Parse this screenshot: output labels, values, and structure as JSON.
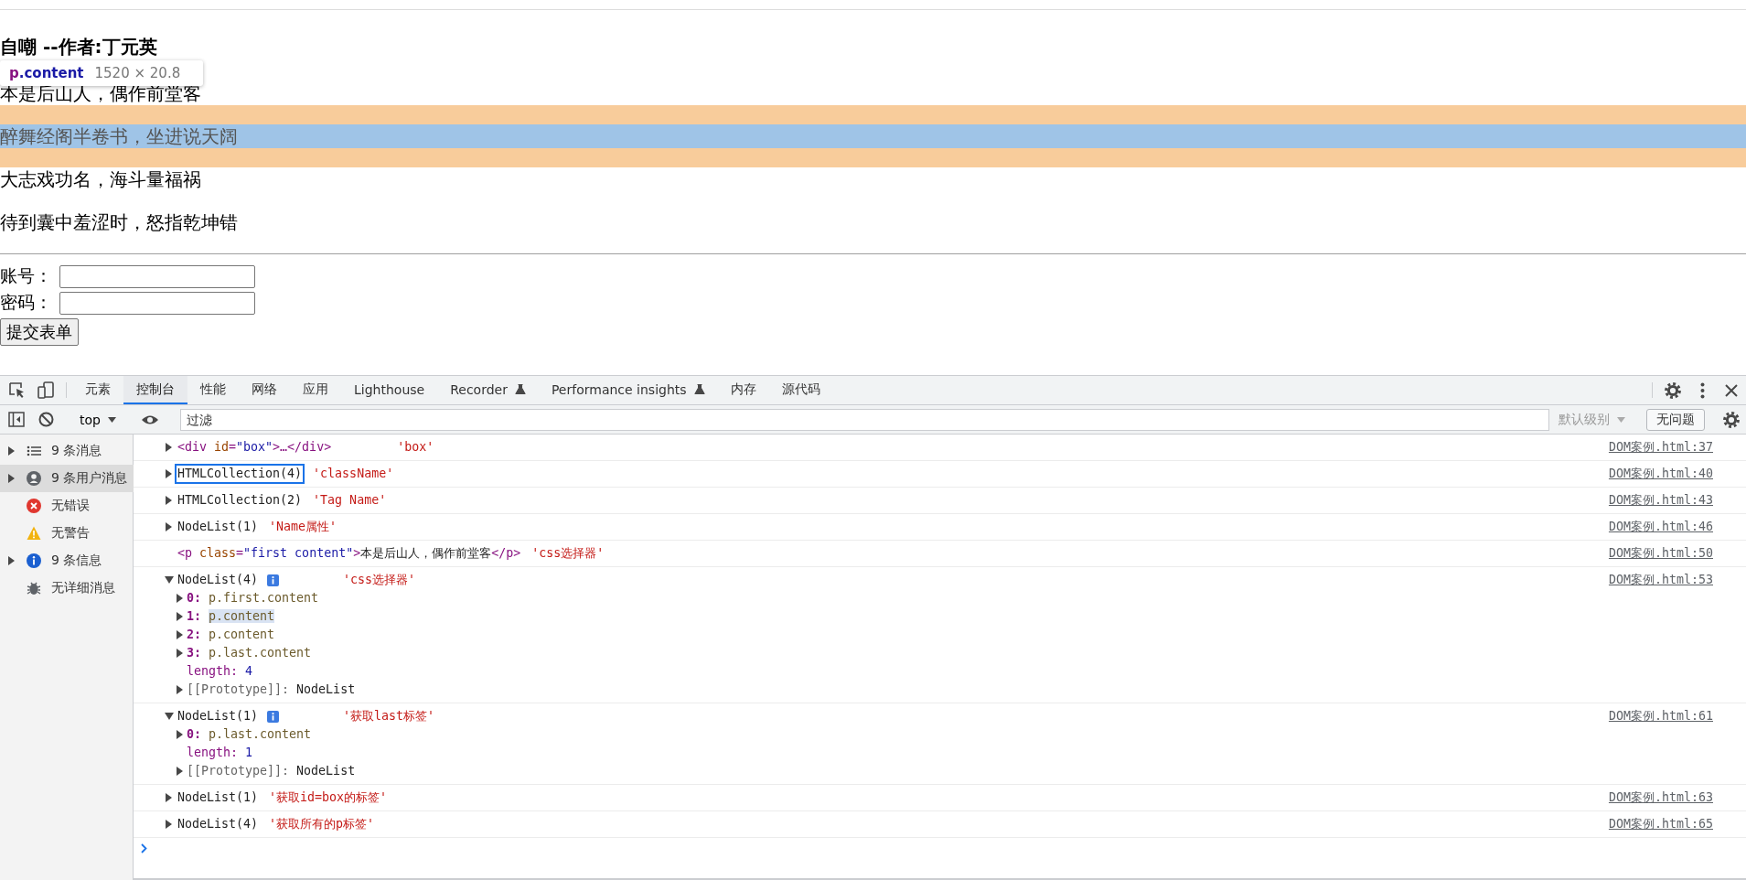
{
  "page": {
    "title": "自嘲 --作者:丁元英",
    "paragraphs": [
      {
        "text": "本是后山人，偶作前堂客",
        "highlighted": false
      },
      {
        "text": "醉舞经阁半卷书，坐进说天阔",
        "highlighted": true
      },
      {
        "text": "大志戏功名，海斗量福祸",
        "highlighted": false
      },
      {
        "text": "待到囊中羞涩时，怒指乾坤错",
        "highlighted": false
      }
    ],
    "form": {
      "fields": [
        {
          "label": "账号："
        },
        {
          "label": "密码："
        }
      ],
      "submit": "提交表单"
    }
  },
  "inspect_tooltip": {
    "tag": "p",
    "class": ".content",
    "size": "1520 × 20.8"
  },
  "devtools": {
    "tabs": [
      {
        "label": "元素",
        "selected": false,
        "experimental": false
      },
      {
        "label": "控制台",
        "selected": true,
        "experimental": false
      },
      {
        "label": "性能",
        "selected": false,
        "experimental": false
      },
      {
        "label": "网络",
        "selected": false,
        "experimental": false
      },
      {
        "label": "应用",
        "selected": false,
        "experimental": false
      },
      {
        "label": "Lighthouse",
        "selected": false,
        "experimental": false
      },
      {
        "label": "Recorder",
        "selected": false,
        "experimental": true
      },
      {
        "label": "Performance insights",
        "selected": false,
        "experimental": true
      },
      {
        "label": "内存",
        "selected": false,
        "experimental": false
      },
      {
        "label": "源代码",
        "selected": false,
        "experimental": false
      }
    ],
    "toolbar": {
      "context": "top",
      "filter_placeholder": "过滤",
      "levels": "默认级别",
      "issues": "无问题"
    },
    "sidebar": [
      {
        "label": "9 条消息",
        "kind": "list",
        "expandable": true,
        "selected": false
      },
      {
        "label": "9 条用户消息",
        "kind": "user",
        "expandable": true,
        "selected": true
      },
      {
        "label": "无错误",
        "kind": "error",
        "expandable": false,
        "selected": false
      },
      {
        "label": "无警告",
        "kind": "warning",
        "expandable": false,
        "selected": false
      },
      {
        "label": "9 条信息",
        "kind": "info",
        "expandable": true,
        "selected": false
      },
      {
        "label": "无详细消息",
        "kind": "verbose",
        "expandable": false,
        "selected": false
      }
    ],
    "console": [
      {
        "kind": "element",
        "expandable": true,
        "parts": [
          {
            "text": "<div ",
            "kind": "tag"
          },
          {
            "text": "id",
            "kind": "attr"
          },
          {
            "text": "=",
            "kind": "tag"
          },
          {
            "text": "\"box\"",
            "kind": "value"
          },
          {
            "text": ">…</div>",
            "kind": "tag"
          }
        ],
        "label": "'box'",
        "source": "DOM案例.html:37"
      },
      {
        "kind": "collection",
        "expanded": false,
        "focused": true,
        "summary": "HTMLCollection(4)",
        "label": "'className'",
        "source": "DOM案例.html:40"
      },
      {
        "kind": "collection",
        "expanded": false,
        "focused": false,
        "summary": "HTMLCollection(2)",
        "label": "'Tag Name'",
        "source": "DOM案例.html:43"
      },
      {
        "kind": "collection",
        "expanded": false,
        "focused": false,
        "summary": "NodeList(1)",
        "label": "'Name属性'",
        "source": "DOM案例.html:46"
      },
      {
        "kind": "element",
        "expandable": false,
        "parts": [
          {
            "text": "<p ",
            "kind": "tag"
          },
          {
            "text": "class",
            "kind": "attr"
          },
          {
            "text": "=",
            "kind": "tag"
          },
          {
            "text": "\"first content\"",
            "kind": "value"
          },
          {
            "text": ">",
            "kind": "tag"
          },
          {
            "text": "本是后山人，偶作前堂客",
            "kind": "text"
          },
          {
            "text": "</p>",
            "kind": "tag"
          }
        ],
        "label": "'css选择器'",
        "source": "DOM案例.html:50"
      },
      {
        "kind": "collection",
        "expanded": true,
        "focused": false,
        "summary": "NodeList(4)",
        "label": "'css选择器'",
        "source": "DOM案例.html:53",
        "children": [
          {
            "kind": "index",
            "key": "0:",
            "value": "p.first.content",
            "expandable": true,
            "hovered": false
          },
          {
            "kind": "index",
            "key": "1:",
            "value": "p.content",
            "expandable": true,
            "hovered": true
          },
          {
            "kind": "index",
            "key": "2:",
            "value": "p.content",
            "expandable": true,
            "hovered": false
          },
          {
            "kind": "index",
            "key": "3:",
            "value": "p.last.content",
            "expandable": true,
            "hovered": false
          },
          {
            "kind": "property",
            "key": "length:",
            "value": "4",
            "expandable": false,
            "hovered": false
          },
          {
            "kind": "internal",
            "key": "[[Prototype]]:",
            "value": "NodeList",
            "expandable": true,
            "hovered": false
          }
        ]
      },
      {
        "kind": "collection",
        "expanded": true,
        "focused": false,
        "summary": "NodeList(1)",
        "label": "'获取last标签'",
        "source": "DOM案例.html:61",
        "children": [
          {
            "kind": "index",
            "key": "0:",
            "value": "p.last.content",
            "expandable": true,
            "hovered": false
          },
          {
            "kind": "property",
            "key": "length:",
            "value": "1",
            "expandable": false,
            "hovered": false
          },
          {
            "kind": "internal",
            "key": "[[Prototype]]:",
            "value": "NodeList",
            "expandable": true,
            "hovered": false
          }
        ]
      },
      {
        "kind": "collection",
        "expanded": false,
        "focused": false,
        "summary": "NodeList(1)",
        "label": "'获取id=box的标签'",
        "source": "DOM案例.html:63"
      },
      {
        "kind": "collection",
        "expanded": false,
        "focused": false,
        "summary": "NodeList(4)",
        "label": "'获取所有的p标签'",
        "source": "DOM案例.html:65"
      }
    ]
  }
}
